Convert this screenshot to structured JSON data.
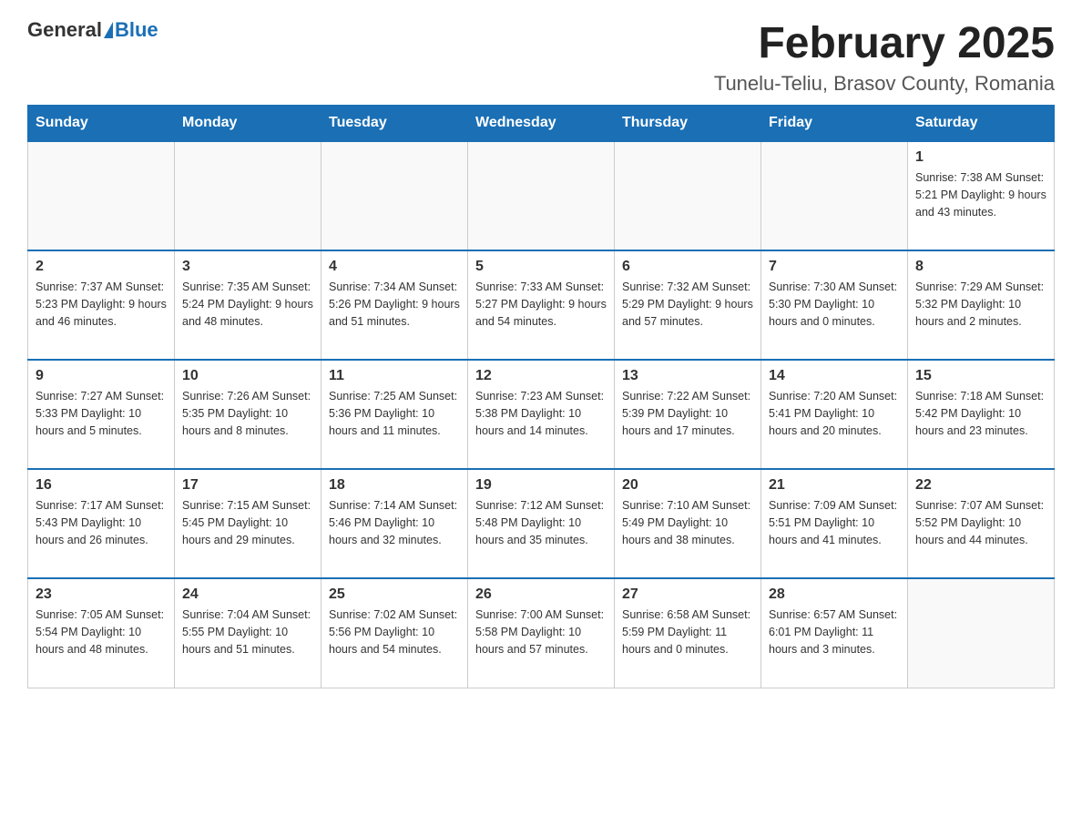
{
  "header": {
    "logo_general": "General",
    "logo_blue": "Blue",
    "month_title": "February 2025",
    "location": "Tunelu-Teliu, Brasov County, Romania"
  },
  "days_of_week": [
    "Sunday",
    "Monday",
    "Tuesday",
    "Wednesday",
    "Thursday",
    "Friday",
    "Saturday"
  ],
  "weeks": [
    [
      {
        "day": "",
        "info": ""
      },
      {
        "day": "",
        "info": ""
      },
      {
        "day": "",
        "info": ""
      },
      {
        "day": "",
        "info": ""
      },
      {
        "day": "",
        "info": ""
      },
      {
        "day": "",
        "info": ""
      },
      {
        "day": "1",
        "info": "Sunrise: 7:38 AM\nSunset: 5:21 PM\nDaylight: 9 hours and 43 minutes."
      }
    ],
    [
      {
        "day": "2",
        "info": "Sunrise: 7:37 AM\nSunset: 5:23 PM\nDaylight: 9 hours and 46 minutes."
      },
      {
        "day": "3",
        "info": "Sunrise: 7:35 AM\nSunset: 5:24 PM\nDaylight: 9 hours and 48 minutes."
      },
      {
        "day": "4",
        "info": "Sunrise: 7:34 AM\nSunset: 5:26 PM\nDaylight: 9 hours and 51 minutes."
      },
      {
        "day": "5",
        "info": "Sunrise: 7:33 AM\nSunset: 5:27 PM\nDaylight: 9 hours and 54 minutes."
      },
      {
        "day": "6",
        "info": "Sunrise: 7:32 AM\nSunset: 5:29 PM\nDaylight: 9 hours and 57 minutes."
      },
      {
        "day": "7",
        "info": "Sunrise: 7:30 AM\nSunset: 5:30 PM\nDaylight: 10 hours and 0 minutes."
      },
      {
        "day": "8",
        "info": "Sunrise: 7:29 AM\nSunset: 5:32 PM\nDaylight: 10 hours and 2 minutes."
      }
    ],
    [
      {
        "day": "9",
        "info": "Sunrise: 7:27 AM\nSunset: 5:33 PM\nDaylight: 10 hours and 5 minutes."
      },
      {
        "day": "10",
        "info": "Sunrise: 7:26 AM\nSunset: 5:35 PM\nDaylight: 10 hours and 8 minutes."
      },
      {
        "day": "11",
        "info": "Sunrise: 7:25 AM\nSunset: 5:36 PM\nDaylight: 10 hours and 11 minutes."
      },
      {
        "day": "12",
        "info": "Sunrise: 7:23 AM\nSunset: 5:38 PM\nDaylight: 10 hours and 14 minutes."
      },
      {
        "day": "13",
        "info": "Sunrise: 7:22 AM\nSunset: 5:39 PM\nDaylight: 10 hours and 17 minutes."
      },
      {
        "day": "14",
        "info": "Sunrise: 7:20 AM\nSunset: 5:41 PM\nDaylight: 10 hours and 20 minutes."
      },
      {
        "day": "15",
        "info": "Sunrise: 7:18 AM\nSunset: 5:42 PM\nDaylight: 10 hours and 23 minutes."
      }
    ],
    [
      {
        "day": "16",
        "info": "Sunrise: 7:17 AM\nSunset: 5:43 PM\nDaylight: 10 hours and 26 minutes."
      },
      {
        "day": "17",
        "info": "Sunrise: 7:15 AM\nSunset: 5:45 PM\nDaylight: 10 hours and 29 minutes."
      },
      {
        "day": "18",
        "info": "Sunrise: 7:14 AM\nSunset: 5:46 PM\nDaylight: 10 hours and 32 minutes."
      },
      {
        "day": "19",
        "info": "Sunrise: 7:12 AM\nSunset: 5:48 PM\nDaylight: 10 hours and 35 minutes."
      },
      {
        "day": "20",
        "info": "Sunrise: 7:10 AM\nSunset: 5:49 PM\nDaylight: 10 hours and 38 minutes."
      },
      {
        "day": "21",
        "info": "Sunrise: 7:09 AM\nSunset: 5:51 PM\nDaylight: 10 hours and 41 minutes."
      },
      {
        "day": "22",
        "info": "Sunrise: 7:07 AM\nSunset: 5:52 PM\nDaylight: 10 hours and 44 minutes."
      }
    ],
    [
      {
        "day": "23",
        "info": "Sunrise: 7:05 AM\nSunset: 5:54 PM\nDaylight: 10 hours and 48 minutes."
      },
      {
        "day": "24",
        "info": "Sunrise: 7:04 AM\nSunset: 5:55 PM\nDaylight: 10 hours and 51 minutes."
      },
      {
        "day": "25",
        "info": "Sunrise: 7:02 AM\nSunset: 5:56 PM\nDaylight: 10 hours and 54 minutes."
      },
      {
        "day": "26",
        "info": "Sunrise: 7:00 AM\nSunset: 5:58 PM\nDaylight: 10 hours and 57 minutes."
      },
      {
        "day": "27",
        "info": "Sunrise: 6:58 AM\nSunset: 5:59 PM\nDaylight: 11 hours and 0 minutes."
      },
      {
        "day": "28",
        "info": "Sunrise: 6:57 AM\nSunset: 6:01 PM\nDaylight: 11 hours and 3 minutes."
      },
      {
        "day": "",
        "info": ""
      }
    ]
  ]
}
